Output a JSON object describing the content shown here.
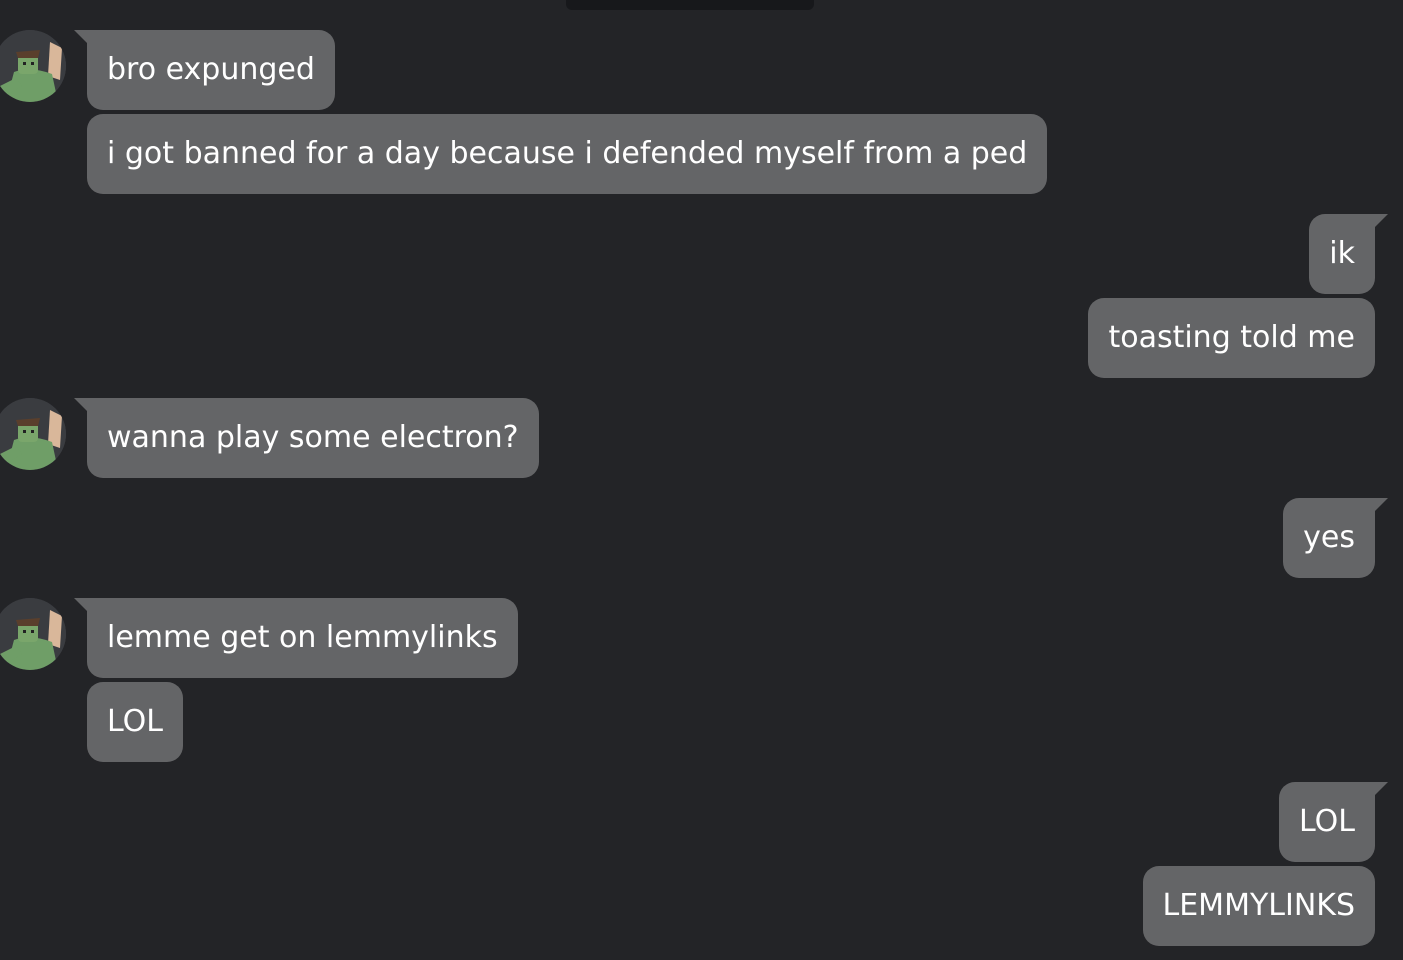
{
  "conversation": {
    "contact_avatar_icon": "roblox-avatar-icon",
    "bubble_color": "#646567",
    "background_color": "#232427",
    "messages": [
      {
        "sender": "them",
        "text": "bro expunged"
      },
      {
        "sender": "them",
        "text": "i got banned for a day because i defended myself from a ped"
      },
      {
        "sender": "me",
        "text": "ik"
      },
      {
        "sender": "me",
        "text": "toasting told me"
      },
      {
        "sender": "them",
        "text": "wanna play some electron?"
      },
      {
        "sender": "me",
        "text": "yes"
      },
      {
        "sender": "them",
        "text": "lemme get on lemmylinks"
      },
      {
        "sender": "them",
        "text": "LOL"
      },
      {
        "sender": "me",
        "text": "LOL"
      },
      {
        "sender": "me",
        "text": "LEMMYLINKS"
      }
    ]
  }
}
